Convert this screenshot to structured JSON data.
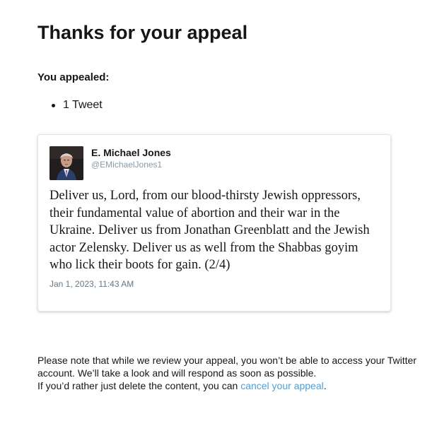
{
  "page": {
    "title": "Thanks for your appeal",
    "subhead": "You appealed:",
    "appealed_items": [
      "1 Tweet"
    ]
  },
  "tweet": {
    "author_name": "E. Michael Jones",
    "author_handle": "@EMichaelJones1",
    "text": "Deliver us, Lord, from our blood-thirsty Jewish oppressors, their fundamental value of abortion and their war in the Ukraine. Deliver us from Jonathan Greenblatt and the Jewish actor Zelensky. Deliver us as well from the Shabbas goyim who lick their boots for gain. (2/4)",
    "timestamp": "Jan 1, 2023, 11:43 AM",
    "avatar_icon": "profile-photo"
  },
  "notice": {
    "note": "Please note that while we review your appeal, you won’t be able to access your Twitter account. We’ll take a look and will respond as soon as possible.",
    "cancel_prefix": "If you’d rather just delete the content, you can ",
    "cancel_link": "cancel your appeal",
    "cancel_suffix": "."
  },
  "colors": {
    "text": "#14171a",
    "link": "#4a9fdc",
    "muted": "#8899a6",
    "card_border": "#e1e8ed"
  }
}
